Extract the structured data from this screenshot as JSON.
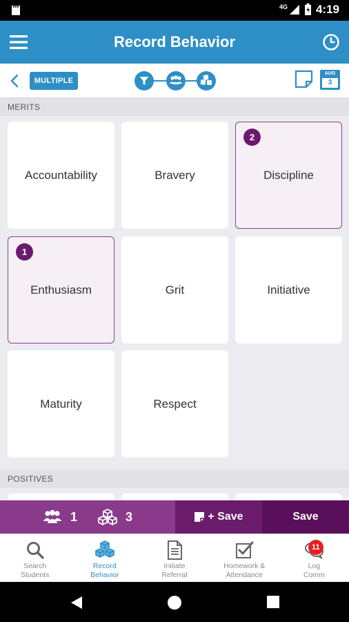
{
  "status_bar": {
    "network": "4G",
    "time": "4:19"
  },
  "app_bar": {
    "title": "Record Behavior"
  },
  "toolbar": {
    "mode_label": "MULTIPLE",
    "date_month": "AUG",
    "date_day": "3"
  },
  "sections": {
    "merits_label": "MERITS",
    "positives_label": "POSITIVES"
  },
  "merits": [
    {
      "label": "Accountability",
      "count": null
    },
    {
      "label": "Bravery",
      "count": null
    },
    {
      "label": "Discipline",
      "count": "2"
    },
    {
      "label": "Enthusiasm",
      "count": "1"
    },
    {
      "label": "Grit",
      "count": null
    },
    {
      "label": "Initiative",
      "count": null
    },
    {
      "label": "Maturity",
      "count": null
    },
    {
      "label": "Respect",
      "count": null
    }
  ],
  "action_bar": {
    "students_count": "1",
    "behaviors_count": "3",
    "note_save_label": "+ Save",
    "save_label": "Save"
  },
  "bottom_nav": {
    "items": [
      {
        "label": "Search\nStudents",
        "icon": "search-icon"
      },
      {
        "label": "Record\nBehavior",
        "icon": "cubes-icon"
      },
      {
        "label": "Initiate\nReferral",
        "icon": "document-icon"
      },
      {
        "label": "Homework &\nAttendance",
        "icon": "checkbox-icon"
      },
      {
        "label": "Log\nComm",
        "icon": "chat-icon"
      }
    ],
    "log_comm_badge": "11"
  },
  "colors": {
    "primary_blue": "#2e8fc6",
    "purple": "#8b3a8b",
    "dark_purple": "#5a0f5a",
    "badge_red": "#e62020"
  }
}
